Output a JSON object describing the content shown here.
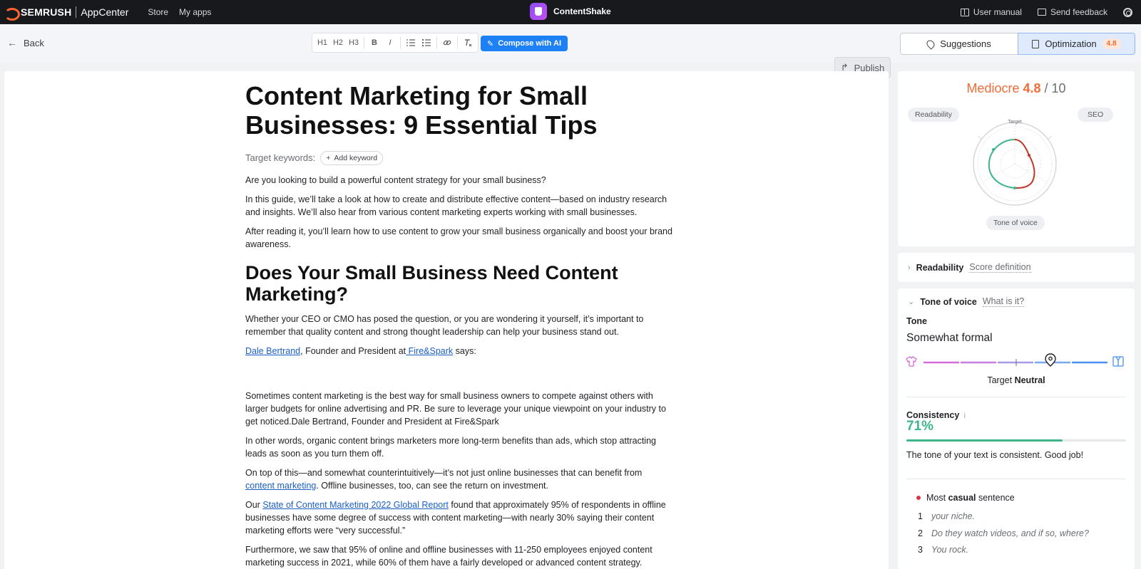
{
  "topbar": {
    "brand": "SEMRUSH",
    "app_center": "AppCenter",
    "nav": [
      "Store",
      "My apps"
    ],
    "app_name": "ContentShake",
    "user_manual": "User manual",
    "send_feedback": "Send feedback"
  },
  "toolbar": {
    "back": "Back",
    "format_buttons": [
      "H1",
      "H2",
      "H3",
      "B",
      "I"
    ],
    "compose": "Compose with AI",
    "publish": "Publish",
    "tab_suggestions": "Suggestions",
    "tab_optimization": "Optimization",
    "optimization_badge": "4.8"
  },
  "document": {
    "title": "Content Marketing for Small Businesses: 9 Essential Tips",
    "target_keywords_label": "Target keywords:",
    "add_keyword": "Add keyword",
    "p1": "Are you looking to build a powerful content strategy for your small business?",
    "p2": "In this guide, we’ll take a look at how to create and distribute effective content—based on industry research and insights. We’ll also hear from various content marketing experts working with small businesses.",
    "p3": "After reading it, you’ll learn how to use content to grow your small business organically and boost your brand awareness.",
    "h2": "Does Your Small Business Need Content Marketing?",
    "p4": "Whether your CEO or CMO has posed the question, or you are wondering it yourself, it’s important to remember that quality content and strong thought leadership can help your business stand out.",
    "p5_link1": "Dale Bertrand",
    "p5_mid": ", Founder and President at",
    "p5_link2": " Fire&Spark",
    "p5_end": " says:",
    "p6": "Sometimes content marketing is the best way for small business owners to compete against others with larger budgets for online advertising and PR. Be sure to leverage your unique viewpoint on your industry to get noticed.Dale Bertrand, Founder and President at Fire&Spark",
    "p7": "In other words, organic content brings marketers more long-term benefits than ads, which stop attracting leads as soon as you turn them off.",
    "p8_start": "On top of this—and somewhat counterintuitively—it’s not just online businesses that can benefit from ",
    "p8_link": "content marketing",
    "p8_end": ". Offline businesses, too, can see the return on investment.",
    "p9_start": "Our ",
    "p9_link": "State of Content Marketing 2022 Global Report",
    "p9_end": " found that approximately 95% of respondents in offline businesses have some degree of success with content marketing—with nearly 30% saying their content marketing efforts were “very successful.”",
    "p10": "Furthermore, we saw that 95% of online and offline businesses with 11-250 employees enjoyed content marketing success in 2021, while 60% of them have a fairly developed or advanced content strategy."
  },
  "score": {
    "label": "Mediocre",
    "value": "4.8",
    "max": "/ 10",
    "radar_readability": "Readability",
    "radar_seo": "SEO",
    "radar_target": "Target",
    "radar_tone": "Tone of voice"
  },
  "readability": {
    "title": "Readability",
    "link": "Score definition"
  },
  "tone": {
    "title": "Tone of voice",
    "link": "What is it?",
    "tone_label": "Tone",
    "tone_value": "Somewhat formal",
    "target_prefix": "Target",
    "target_value": "Neutral",
    "slider_position": 0.69,
    "consistency_label": "Consistency",
    "consistency_value": "71%",
    "consistency_fraction": 0.71,
    "consistency_text": "The tone of your text is consistent. Good job!",
    "casual_prefix": "Most",
    "casual_bold": "casual",
    "casual_suffix": "sentence",
    "sentences": [
      {
        "n": "1",
        "text": "your niche."
      },
      {
        "n": "2",
        "text": "Do they watch videos, and if so, where?"
      },
      {
        "n": "3",
        "text": "You rock."
      }
    ]
  },
  "colors": {
    "accent": "#1d80f5",
    "score": "#f26b36",
    "good": "#3fb58a",
    "bad": "#c0392b"
  }
}
